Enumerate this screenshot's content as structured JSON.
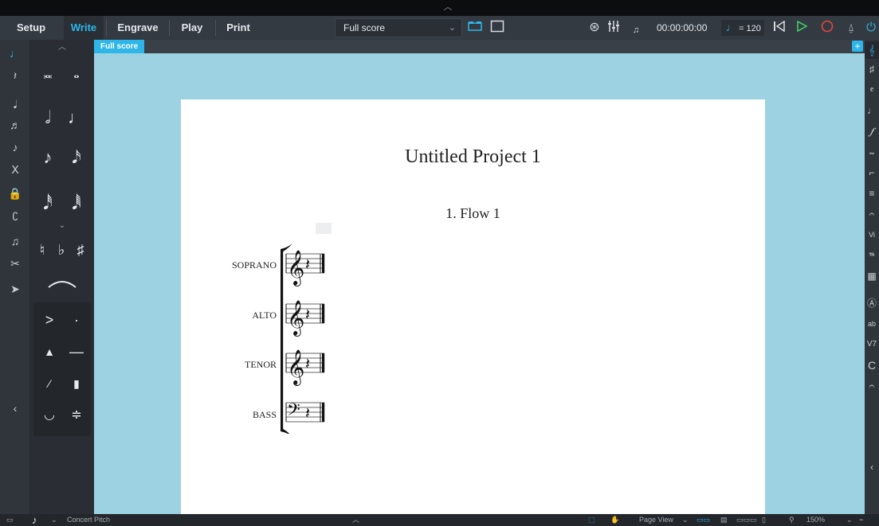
{
  "toolbar": {
    "modes": [
      {
        "label": "Setup",
        "active": false
      },
      {
        "label": "Write",
        "active": true
      },
      {
        "label": "Engrave",
        "active": false
      },
      {
        "label": "Play",
        "active": false
      },
      {
        "label": "Print",
        "active": false
      }
    ],
    "layout_select": "Full score",
    "timecode": "00:00:00:00",
    "tempo": "= 120",
    "icons": [
      "galley-view-icon",
      "page-view-icon",
      "video-icon",
      "mixer-icon",
      "click-icon",
      "rewind-icon",
      "play-icon",
      "record-icon",
      "metronome-icon",
      "power-icon"
    ]
  },
  "tabs": [
    {
      "label": "Full score"
    }
  ],
  "score": {
    "title": "Untitled Project 1",
    "flow_title": "1. Flow 1",
    "instruments": [
      {
        "name": "SOPRANO",
        "clef": "treble"
      },
      {
        "name": "ALTO",
        "clef": "treble"
      },
      {
        "name": "TENOR",
        "clef": "treble-8vb"
      },
      {
        "name": "BASS",
        "clef": "bass"
      }
    ]
  },
  "statusbar": {
    "pitch": "Concert Pitch",
    "view": "Page View",
    "zoom": "150%"
  },
  "colors": {
    "accent": "#2eb6e8",
    "canvas": "#9dd2e3",
    "toolbar": "#343a42"
  }
}
